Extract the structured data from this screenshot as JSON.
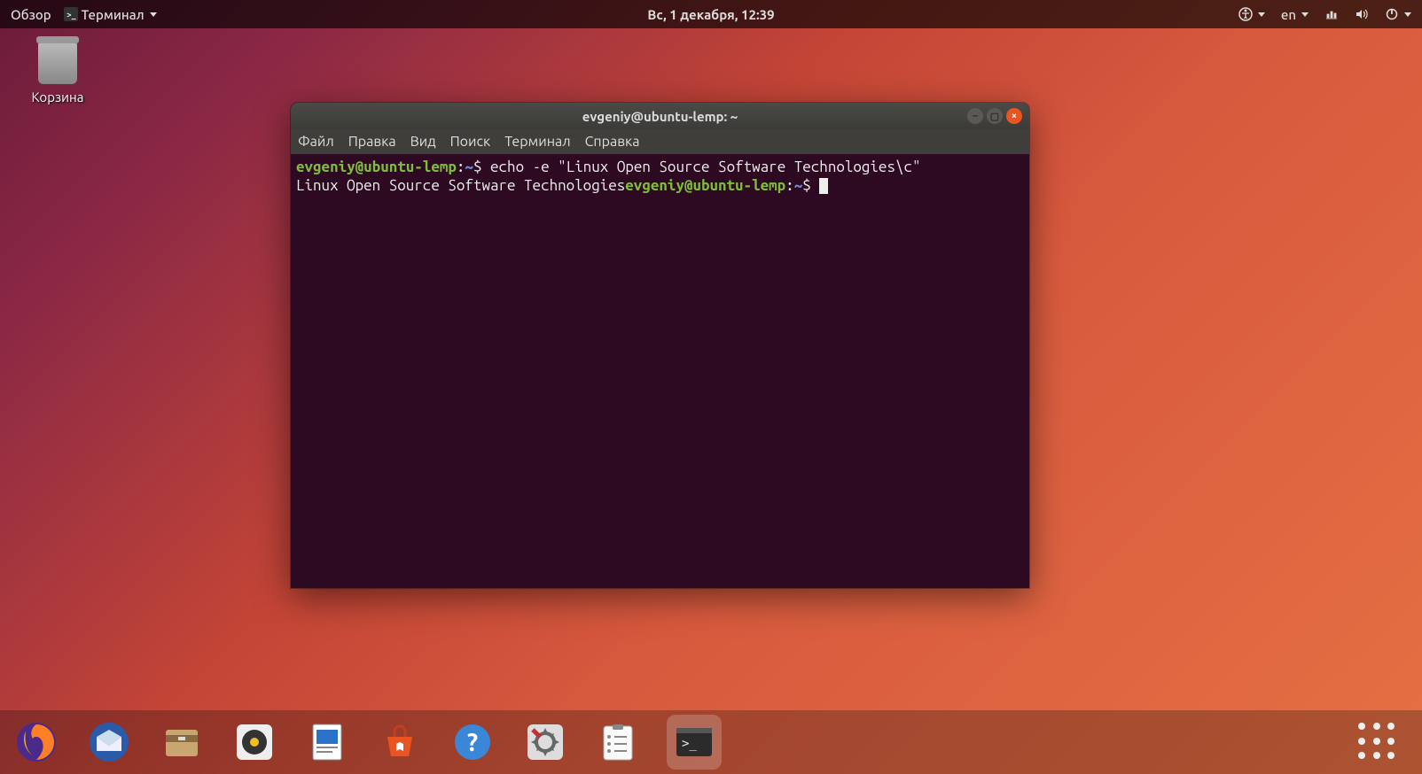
{
  "topbar": {
    "overview": "Обзор",
    "app_name": "Терминал",
    "datetime": "Вс, 1 декабря, 12:39",
    "lang": "en"
  },
  "desktop": {
    "trash_label": "Корзина"
  },
  "terminal": {
    "title": "evgeniy@ubuntu-lemp: ~",
    "menu": {
      "file": "Файл",
      "edit": "Правка",
      "view": "Вид",
      "search": "Поиск",
      "terminal": "Терминал",
      "help": "Справка"
    },
    "prompt": {
      "user_host": "evgeniy@ubuntu-lemp",
      "sep": ":",
      "path": "~",
      "symbol": "$"
    },
    "command": "echo -e \"Linux Open Source Software Technologies\\c\"",
    "output": "Linux Open Source Software Technologies"
  },
  "dock": {
    "items": [
      "firefox",
      "thunderbird",
      "files",
      "rhythmbox",
      "libreoffice-writer",
      "ubuntu-software",
      "help",
      "settings",
      "todo",
      "terminal"
    ]
  }
}
